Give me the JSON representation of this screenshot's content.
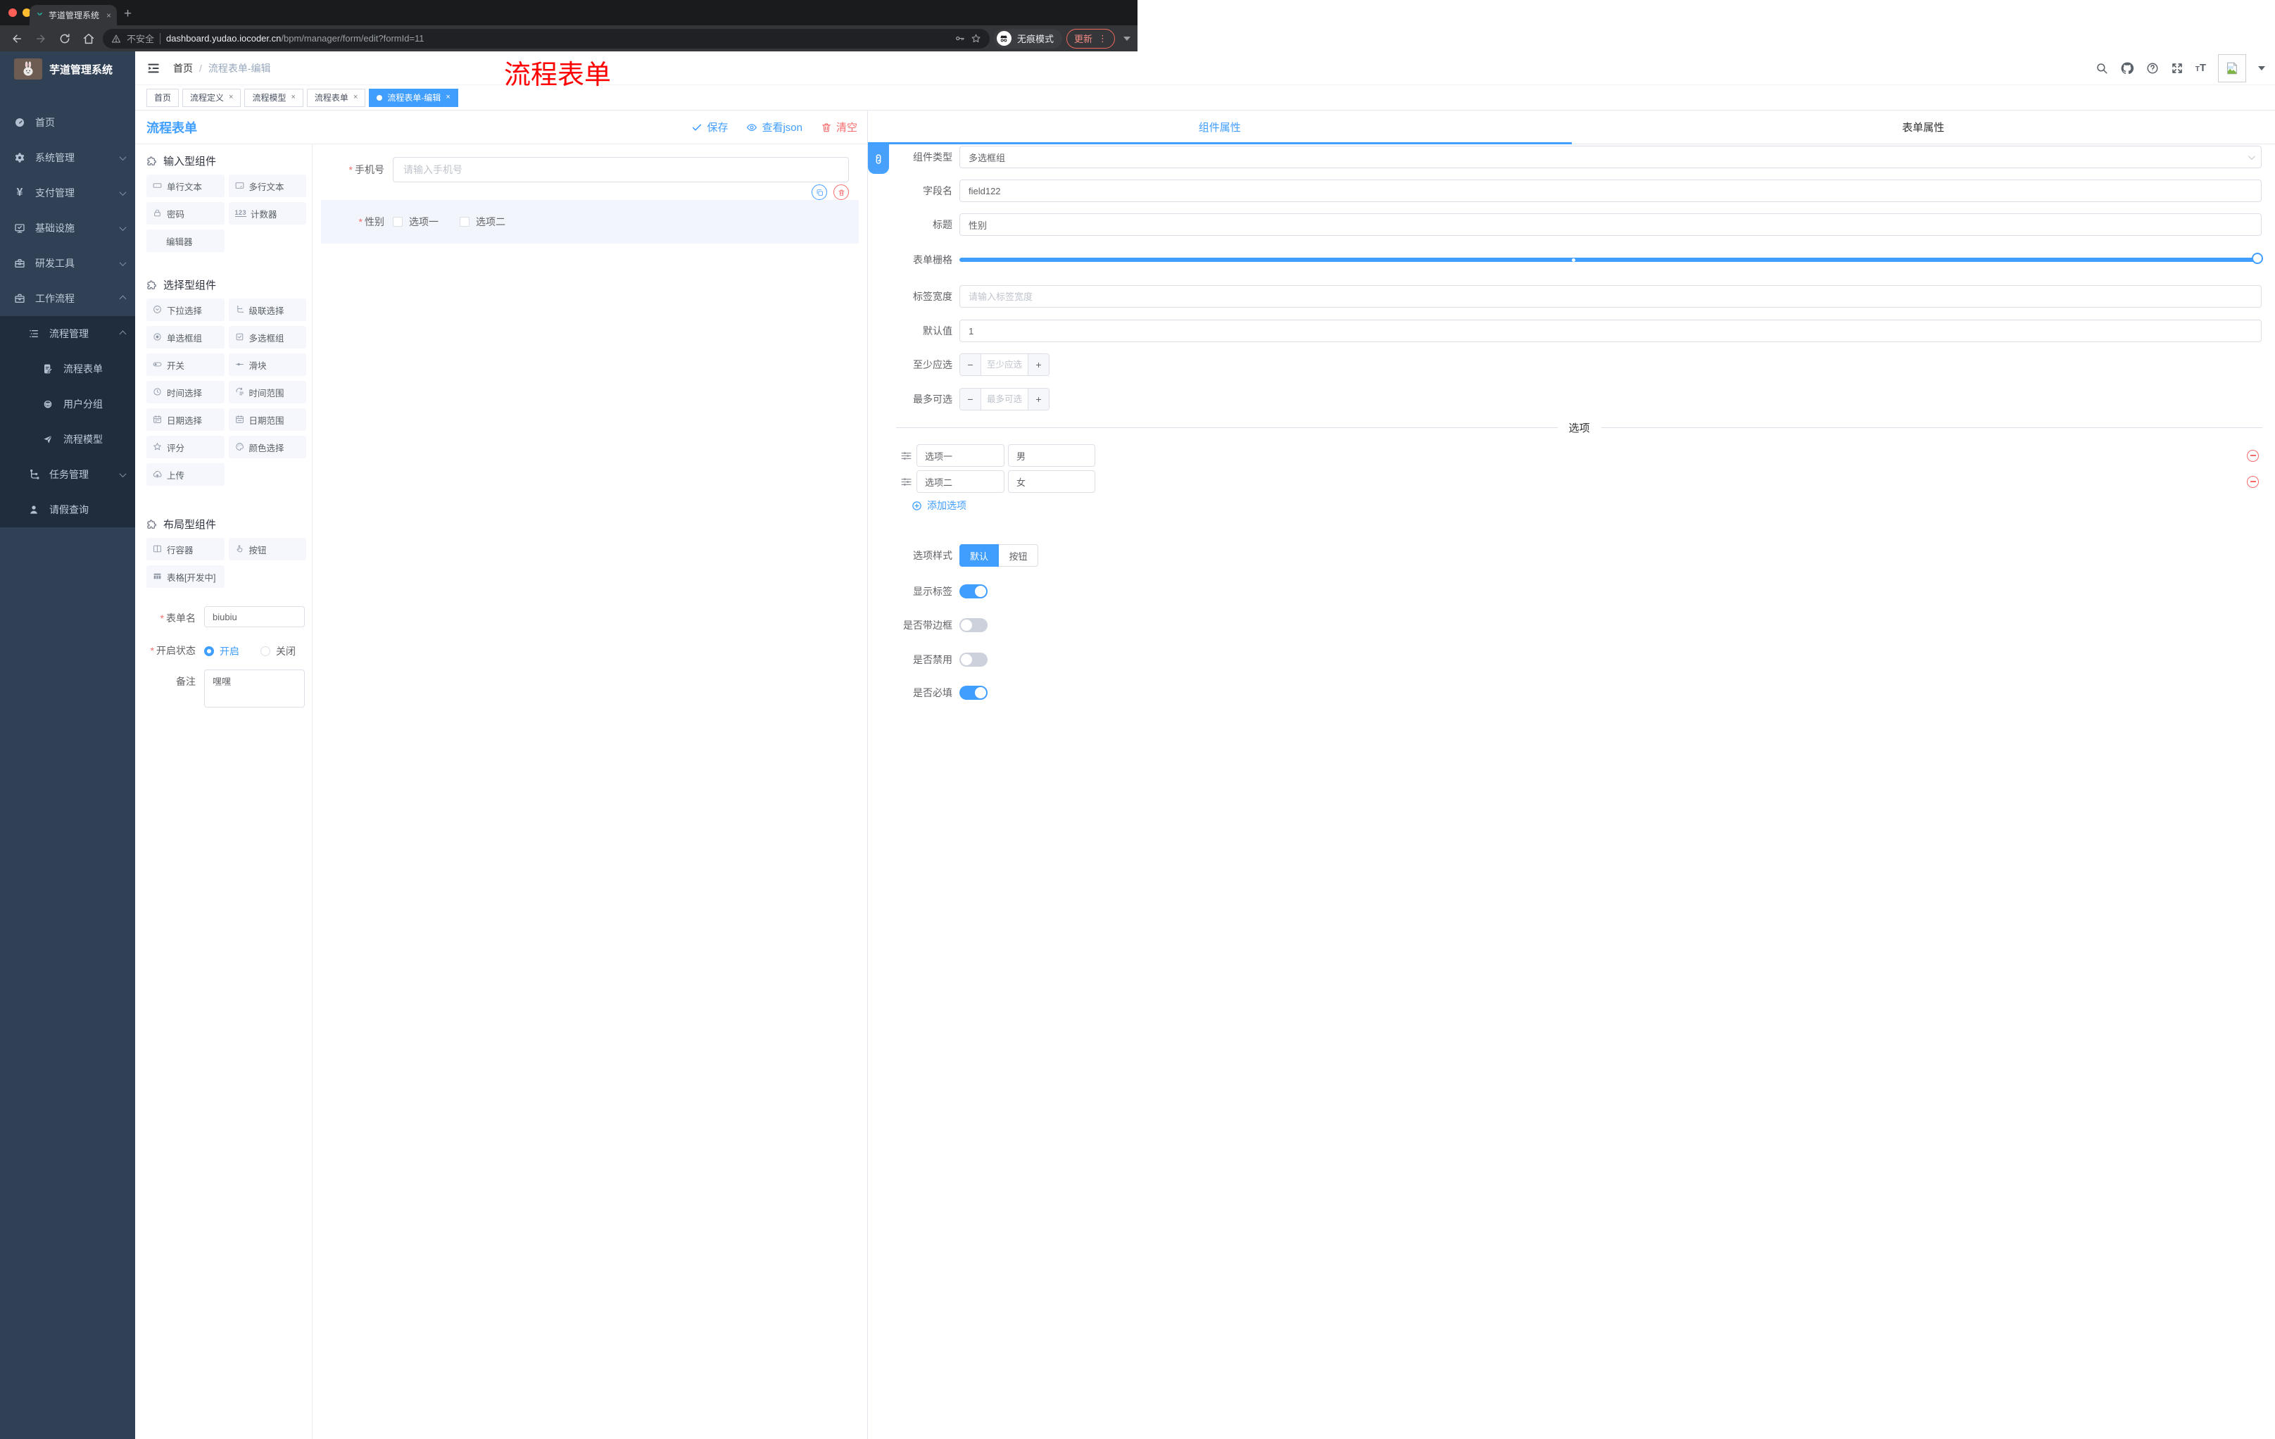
{
  "browser": {
    "tab_title": "芋道管理系统",
    "new_tab": "+",
    "close_tab": "×",
    "security_label": "不安全",
    "url_host": "dashboard.yudao.iocoder.cn",
    "url_path": "/bpm/manager/form/edit?formId=11",
    "incognito_label": "无痕模式",
    "update_label": "更新",
    "menu_dots": "⋮"
  },
  "sidebar": {
    "app_title": "芋道管理系统",
    "menu": [
      {
        "label": "首页"
      },
      {
        "label": "系统管理"
      },
      {
        "label": "支付管理"
      },
      {
        "label": "基础设施"
      },
      {
        "label": "研发工具"
      },
      {
        "label": "工作流程"
      }
    ],
    "submenu": [
      {
        "label": "流程管理"
      },
      {
        "label": "流程表单"
      },
      {
        "label": "用户分组"
      },
      {
        "label": "流程模型"
      },
      {
        "label": "任务管理"
      },
      {
        "label": "请假查询"
      }
    ]
  },
  "header": {
    "breadcrumb_home": "首页",
    "breadcrumb_sep": "/",
    "breadcrumb_current": "流程表单-编辑",
    "watermark": "流程表单"
  },
  "tabbar": {
    "tabs": [
      {
        "label": "首页"
      },
      {
        "label": "流程定义"
      },
      {
        "label": "流程模型"
      },
      {
        "label": "流程表单"
      },
      {
        "label": "流程表单-编辑"
      }
    ],
    "close_glyph": "×"
  },
  "designer": {
    "title": "流程表单",
    "actions": {
      "save": "保存",
      "view_json": "查看json",
      "clear": "清空"
    },
    "sections": [
      {
        "title": "输入型组件",
        "items": [
          {
            "label": "单行文本"
          },
          {
            "label": "多行文本"
          },
          {
            "label": "密码"
          },
          {
            "label": "计数器"
          },
          {
            "label": "编辑器"
          }
        ]
      },
      {
        "title": "选择型组件",
        "items": [
          {
            "label": "下拉选择"
          },
          {
            "label": "级联选择"
          },
          {
            "label": "单选框组"
          },
          {
            "label": "多选框组"
          },
          {
            "label": "开关"
          },
          {
            "label": "滑块"
          },
          {
            "label": "时间选择"
          },
          {
            "label": "时间范围"
          },
          {
            "label": "日期选择"
          },
          {
            "label": "日期范围"
          },
          {
            "label": "评分"
          },
          {
            "label": "颜色选择"
          },
          {
            "label": "上传"
          }
        ]
      },
      {
        "title": "布局型组件",
        "items": [
          {
            "label": "行容器"
          },
          {
            "label": "按钮"
          },
          {
            "label": "表格[开发中]"
          }
        ]
      }
    ],
    "counter_icon_text": "123",
    "form": {
      "name_label": "表单名",
      "name_value": "biubiu",
      "status_label": "开启状态",
      "status_on": "开启",
      "status_off": "关闭",
      "remark_label": "备注",
      "remark_value": "嘿嘿"
    },
    "canvas": {
      "phone_label": "手机号",
      "phone_placeholder": "请输入手机号",
      "gender_label": "性别",
      "gender_options": [
        {
          "label": "选项一"
        },
        {
          "label": "选项二"
        }
      ]
    }
  },
  "props": {
    "tabs": [
      {
        "label": "组件属性"
      },
      {
        "label": "表单属性"
      }
    ],
    "type_label": "组件类型",
    "type_value": "多选框组",
    "field_label": "字段名",
    "field_value": "field122",
    "title_label": "标题",
    "title_value": "性别",
    "grid_label": "表单栅格",
    "width_label": "标签宽度",
    "width_placeholder": "请输入标签宽度",
    "default_label": "默认值",
    "default_value": "1",
    "min_label": "至少应选",
    "min_placeholder": "至少应选",
    "max_label": "最多可选",
    "max_placeholder": "最多可选",
    "stepper_minus": "−",
    "stepper_plus": "+",
    "options_divider": "选项",
    "options": [
      {
        "label": "选项一",
        "value": "男"
      },
      {
        "label": "选项二",
        "value": "女"
      }
    ],
    "add_option": "添加选项",
    "style_label": "选项样式",
    "style_choices": [
      {
        "label": "默认"
      },
      {
        "label": "按钮"
      }
    ],
    "toggles": [
      {
        "label": "显示标签",
        "on": true
      },
      {
        "label": "是否带边框",
        "on": false
      },
      {
        "label": "是否禁用",
        "on": false
      },
      {
        "label": "是否必填",
        "on": true
      }
    ]
  },
  "colors": {
    "accent": "#409EFF",
    "danger": "#F56C6C",
    "watermark": "#FE0000",
    "sidebar": "#304156",
    "sidebar_sub": "#1F2D3D"
  }
}
